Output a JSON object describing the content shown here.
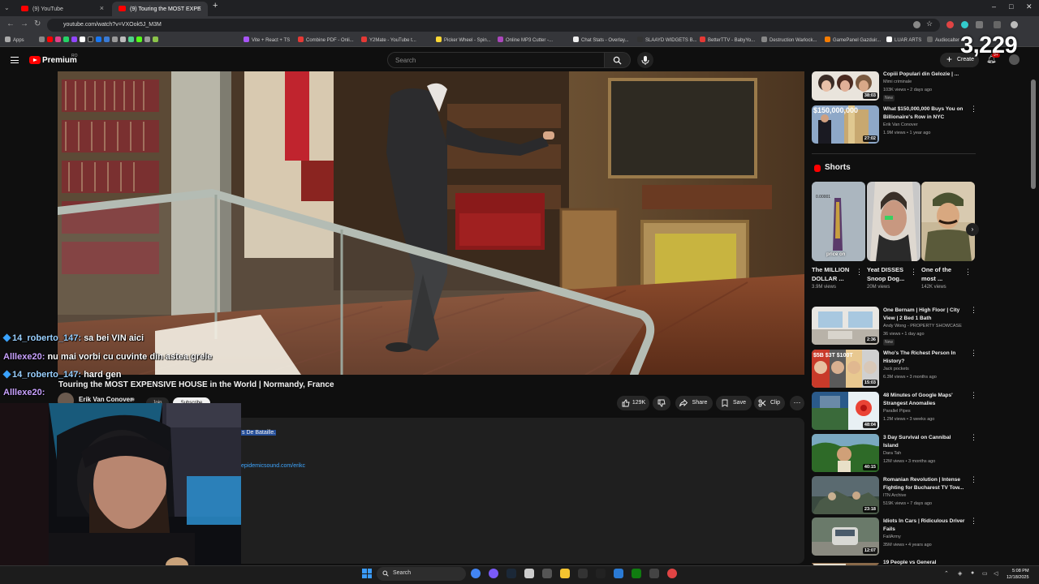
{
  "browser": {
    "tabs": [
      {
        "label": "(9) YouTube"
      },
      {
        "label": "(9) Touring the MOST EXPE"
      }
    ],
    "url": "youtube.com/watch?v=VXOok5J_M3M",
    "bookmarks": [
      "Apps",
      "Vite + React + TS",
      "Combine PDF - Onli...",
      "Y2Mate - YouTube t...",
      "Picker Wheel - Spin...",
      "Online MP3 Cutter -...",
      "Chat Stats - Overlay...",
      "SLAAYD WIDGETS B...",
      "BetterTTV - BabyYo...",
      "Destruction Warlock...",
      "GamePanel Gazduir...",
      "LUAR ARTS",
      "Audiocalter"
    ],
    "overlay_count": "3,229"
  },
  "header": {
    "logo_text": "Premium",
    "logo_sup": "RO",
    "search_placeholder": "Search",
    "create_label": "Create",
    "notif_badge": "9+"
  },
  "chat": [
    {
      "user": "14_roberto_147:",
      "message": "sa bei VIN aici",
      "badge": true
    },
    {
      "user": "Alllexe20:",
      "message": "nu mai vorbi cu cuvinte din astea grele",
      "badge": false
    },
    {
      "user": "14_roberto_147:",
      "message": "hard gen",
      "badge": true
    },
    {
      "user": "Alllexe20:",
      "message": "",
      "badge": false
    }
  ],
  "video": {
    "title": "Touring the MOST EXPENSIVE HOUSE in the World | Normandy, France",
    "channel": "Erik Van Conover",
    "join": "Join",
    "subscribe": "Subscribe",
    "likes": "129K",
    "share": "Share",
    "save": "Save",
    "clip": "Clip",
    "desc_text": "s De Bataille.",
    "desc_link": "epidemicsound.com/erikc"
  },
  "sidebar": {
    "recs_top": [
      {
        "title": "Copiii Populari din Gelozie | ...",
        "channel": "Mimi criminale",
        "meta": "103K views • 2 days ago",
        "new": "New",
        "duration": "38:03"
      },
      {
        "title": "What $150,000,000 Buys You on Billionaire's Row in NYC",
        "channel": "Erik Van Conover",
        "meta": "1.9M views • 1 year ago",
        "new": "",
        "duration": "27:02"
      }
    ],
    "shorts_label": "Shorts",
    "shorts": [
      {
        "title": "The MILLION DOLLAR ...",
        "views": "3.9M views",
        "overlay": "price on"
      },
      {
        "title": "Yeat DISSES Snoop Dog...",
        "views": "20M views",
        "overlay": ""
      },
      {
        "title": "One of the most ...",
        "views": "142K views",
        "overlay": ""
      }
    ],
    "recs": [
      {
        "title": "One Bernam | High Floor | City View | 2 Bed 1 Bath",
        "channel": "Andy Wong - PROPERTY SHOWCASE",
        "meta": "36 views • 1 day ago",
        "new": "New",
        "duration": "2:36"
      },
      {
        "title": "Who's The Richest Person In History?",
        "channel": "Jack pockets",
        "meta": "6.3M views • 3 months ago",
        "new": "",
        "duration": "15:03"
      },
      {
        "title": "48 Minutes of Google Maps' Strangest Anomalies",
        "channel": "Parallel Pipes",
        "meta": "1.2M views • 3 weeks ago",
        "new": "",
        "duration": "48:04"
      },
      {
        "title": "3 Day Survival on Cannibal Island",
        "channel": "Dara Tah",
        "meta": "12M views • 3 months ago",
        "new": "",
        "duration": "40:15"
      },
      {
        "title": "Romanian Revolution | Intense Fighting for Bucharest TV Tow...",
        "channel": "ITN Archive",
        "meta": "519K views • 7 days ago",
        "new": "",
        "duration": "23:18"
      },
      {
        "title": "Idiots In Cars | Ridiculous Driver Fails",
        "channel": "FailArmy",
        "meta": "35M views • 4 years ago",
        "new": "",
        "duration": "12:07"
      },
      {
        "title": "19 People vs General",
        "channel": "",
        "meta": "",
        "new": "",
        "duration": ""
      }
    ]
  },
  "taskbar": {
    "search": "Search",
    "time": "5:08 PM",
    "date": "12/18/2025"
  }
}
